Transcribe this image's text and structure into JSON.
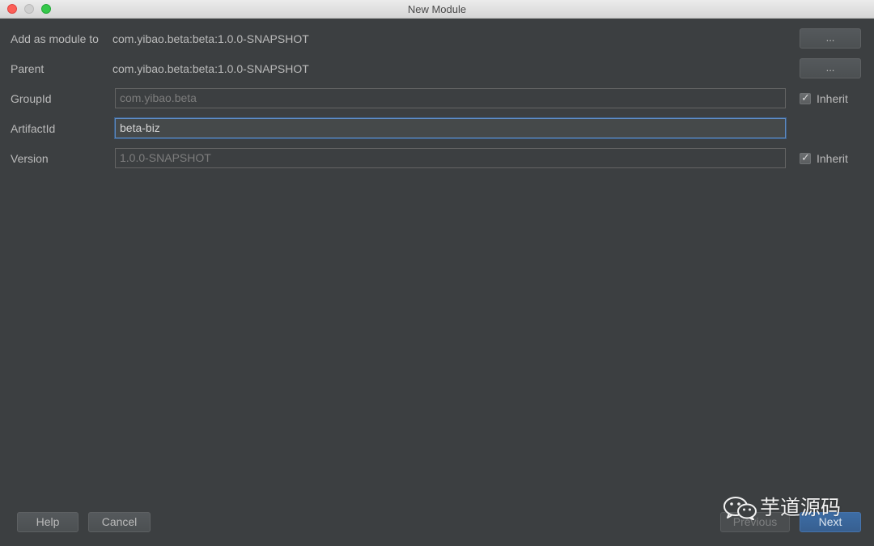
{
  "window": {
    "title": "New Module"
  },
  "form": {
    "add_as_module_to": {
      "label": "Add as module to",
      "value": "com.yibao.beta:beta:1.0.0-SNAPSHOT",
      "button": "..."
    },
    "parent": {
      "label": "Parent",
      "value": "com.yibao.beta:beta:1.0.0-SNAPSHOT",
      "button": "..."
    },
    "group_id": {
      "label": "GroupId",
      "value": "com.yibao.beta",
      "inherit_label": "Inherit",
      "inherit_checked": true
    },
    "artifact_id": {
      "label": "ArtifactId",
      "value": "beta-biz"
    },
    "version": {
      "label": "Version",
      "value": "1.0.0-SNAPSHOT",
      "inherit_label": "Inherit",
      "inherit_checked": true
    }
  },
  "footer": {
    "help": "Help",
    "cancel": "Cancel",
    "previous": "Previous",
    "next": "Next"
  },
  "watermark": {
    "text": "芋道源码",
    "icon": "wechat-icon"
  },
  "colors": {
    "background": "#3c3f41",
    "accent": "#3d6da5"
  }
}
